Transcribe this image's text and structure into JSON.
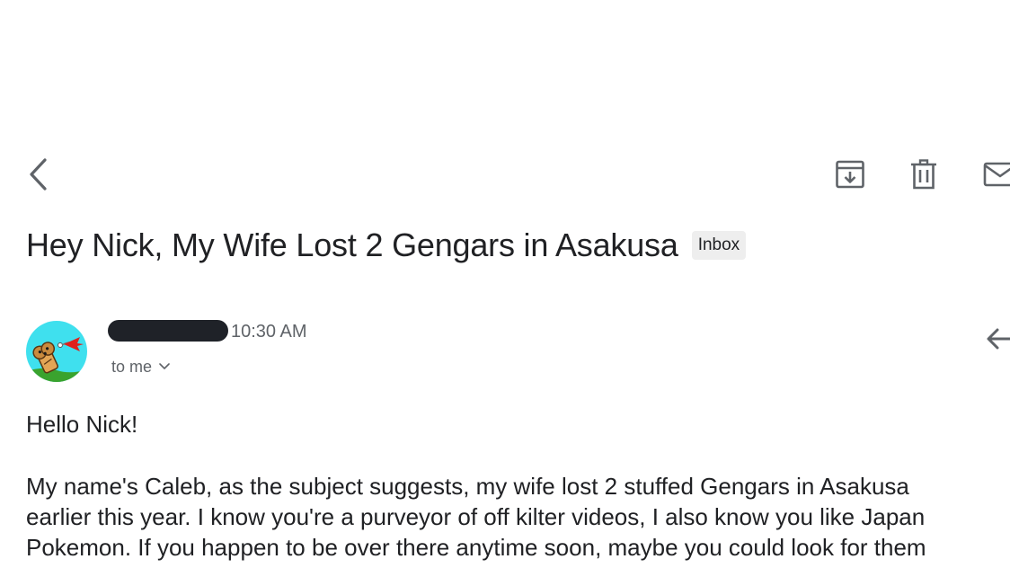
{
  "toolbar": {
    "back_icon": "chevron-left-icon",
    "archive_icon": "archive-icon",
    "delete_icon": "trash-icon",
    "mail_icon": "mail-icon"
  },
  "email": {
    "subject": "Hey Nick, My Wife Lost 2 Gengars in Asakusa",
    "label": "Inbox",
    "time": "10:30 AM",
    "recipient": "to me",
    "greeting": "Hello Nick!",
    "body_lines": [
      "My name's Caleb, as the subject suggests, my wife lost 2 stuffed Gengars in Asakusa",
      "earlier this year. I know you're a purveyor of off kilter videos, I also know you like Japan",
      "Pokemon. If you happen to be over there anytime soon, maybe you could look for them"
    ]
  },
  "colors": {
    "text": "#202124",
    "secondary": "#5f6368",
    "icon": "#5f6368",
    "chip_bg": "#eeeeee",
    "redaction": "#1f2228",
    "avatar_bg": "#3fe0ee"
  }
}
